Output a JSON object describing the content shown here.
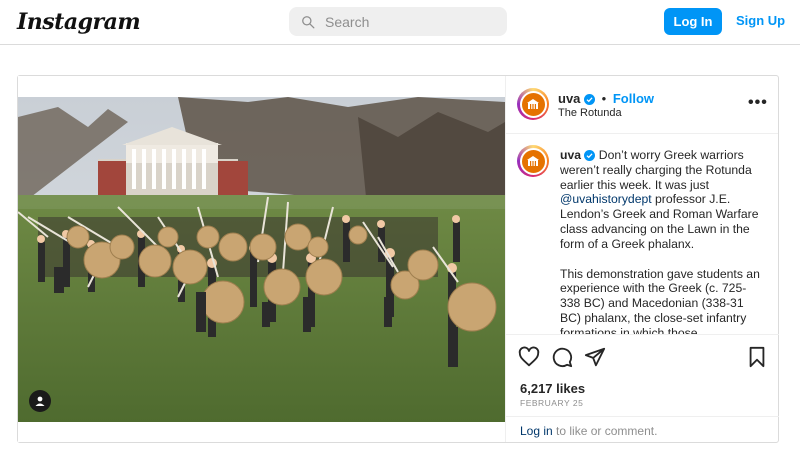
{
  "nav": {
    "logo": "Instagram",
    "search_placeholder": "Search",
    "login_label": "Log In",
    "signup_label": "Sign Up"
  },
  "post": {
    "username": "uva",
    "follow_label": "Follow",
    "separator": "•",
    "location": "The Rotunda",
    "more_label": "•••",
    "caption": {
      "username": "uva",
      "p1_a": " Don’t worry Greek warriors weren’t really charging the Rotunda earlier this week. It was just ",
      "mention": "@uvahistorydept",
      "p1_b": " professor J.E. Lendon’s Greek and Roman Warfare class advancing on the Lawn in the form of a Greek phalanx.",
      "p2": "This demonstration gave students an experience with the Greek (c. 725-338 BC) and Macedonian (338-31 BC) phalanx, the close-set infantry formations in which those"
    },
    "likes": "6,217 likes",
    "date": "FEBRUARY 25",
    "login_link": "Log in",
    "login_suffix": " to like or comment."
  },
  "icons": {
    "search": "search-icon",
    "verified": "verified-badge-icon",
    "like": "heart-icon",
    "comment": "comment-icon",
    "share": "paper-plane-icon",
    "save": "bookmark-icon",
    "tagged": "user-tag-icon"
  },
  "colors": {
    "accent": "#0095f6",
    "uva_orange": "#e57200",
    "mention": "#00376b",
    "muted": "#8e8e8e"
  }
}
